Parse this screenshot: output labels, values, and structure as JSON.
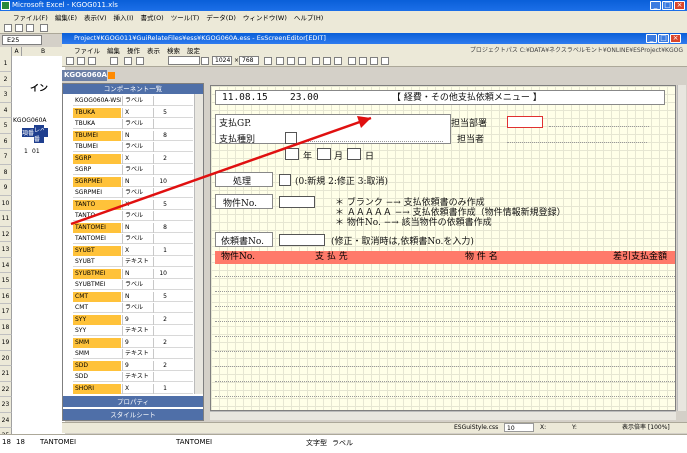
{
  "excel": {
    "title": "Microsoft Excel - KGOG011.xls",
    "menu": [
      "ファイル(F)",
      "編集(E)",
      "表示(V)",
      "挿入(I)",
      "書式(O)",
      "ツール(T)",
      "データ(D)",
      "ウィンドウ(W)",
      "ヘルプ(H)"
    ],
    "namebox": "E25",
    "col_headers": [
      "A",
      "B"
    ],
    "row_numbers": [
      "1",
      "2",
      "3",
      "4",
      "5",
      "6",
      "7",
      "8",
      "9",
      "10",
      "11",
      "12",
      "13",
      "14",
      "15",
      "16",
      "17",
      "18",
      "19",
      "20",
      "21",
      "22",
      "23",
      "24",
      "25"
    ],
    "cells": {
      "title_frag": "イン",
      "r5": "KGOG060A",
      "r6a": "項番",
      "r6b": "レベ",
      "r7": "番",
      "r8": "1",
      "r8b": "01",
      "bottom_row": "18",
      "bottom_b": "18",
      "bottom_c": "TANTOMEI",
      "bottom_d": "TANTOMEI",
      "bottom_e": "文字型",
      "bottom_f": "ラベル"
    }
  },
  "editor": {
    "title": "Project¥KGOG011¥GuiRelateFiles¥ess¥KGOG060A.ess - EsScreenEditor[EDIT]",
    "menu": [
      "ファイル",
      "編集",
      "操作",
      "表示",
      "検索",
      "設定"
    ],
    "project_path": "プロジェクトパス  C:¥DATA¥ネクスラベルモント¥ONLINE¥ESProject¥KGOG",
    "size_w": "1024",
    "size_h": "768",
    "form_tab": "KGOG060A",
    "status_style": "ESGuiStyle.css",
    "status_x": "10",
    "status_x_label": "X:",
    "status_y_label": "Y:",
    "status_zoom": "表示倍率 [100%]"
  },
  "components": {
    "header": "コンポーネント一覧",
    "rows": [
      {
        "name": "KGOG060A-WSNAME",
        "type": "ラベル",
        "len": "",
        "hl": false
      },
      {
        "name": "TBUKA",
        "type": "X",
        "len": "5",
        "hl": true
      },
      {
        "name": "TBUKA",
        "type": "ラベル",
        "len": "",
        "hl": false
      },
      {
        "name": "TBUMEI",
        "type": "N",
        "len": "8",
        "hl": true
      },
      {
        "name": "TBUMEI",
        "type": "ラベル",
        "len": "",
        "hl": false
      },
      {
        "name": "SGRP",
        "type": "X",
        "len": "2",
        "hl": true
      },
      {
        "name": "SGRP",
        "type": "ラベル",
        "len": "",
        "hl": false
      },
      {
        "name": "SGRPMEI",
        "type": "N",
        "len": "10",
        "hl": true
      },
      {
        "name": "SGRPMEI",
        "type": "ラベル",
        "len": "",
        "hl": false
      },
      {
        "name": "TANTO",
        "type": "X",
        "len": "5",
        "hl": true
      },
      {
        "name": "TANTO",
        "type": "ラベル",
        "len": "",
        "hl": false
      },
      {
        "name": "TANTOMEI",
        "type": "N",
        "len": "8",
        "hl": true
      },
      {
        "name": "TANTOMEI",
        "type": "ラベル",
        "len": "",
        "hl": false
      },
      {
        "name": "SYUBT",
        "type": "X",
        "len": "1",
        "hl": true
      },
      {
        "name": "SYUBT",
        "type": "テキスト",
        "len": "",
        "hl": false
      },
      {
        "name": "SYUBTMEI",
        "type": "N",
        "len": "10",
        "hl": true
      },
      {
        "name": "SYUBTMEI",
        "type": "ラベル",
        "len": "",
        "hl": false
      },
      {
        "name": "CMT",
        "type": "N",
        "len": "5",
        "hl": true
      },
      {
        "name": "CMT",
        "type": "ラベル",
        "len": "",
        "hl": false
      },
      {
        "name": "SYY",
        "type": "9",
        "len": "2",
        "hl": true
      },
      {
        "name": "SYY",
        "type": "テキスト",
        "len": "",
        "hl": false
      },
      {
        "name": "SMM",
        "type": "9",
        "len": "2",
        "hl": true
      },
      {
        "name": "SMM",
        "type": "テキスト",
        "len": "",
        "hl": false
      },
      {
        "name": "SDD",
        "type": "9",
        "len": "2",
        "hl": true
      },
      {
        "name": "SDD",
        "type": "テキスト",
        "len": "",
        "hl": false
      },
      {
        "name": "SHORI",
        "type": "X",
        "len": "1",
        "hl": true
      }
    ],
    "property_button": "プロパティ",
    "stylesheet_button": "スタイルシート"
  },
  "form": {
    "date": "11.08.15",
    "time": "23.00",
    "screen_title": "【 経費・その他支払依頼メニュー 】",
    "label_sgrp": "支払GP.",
    "label_dept": "担当部署",
    "label_type": "支払種別",
    "label_person": "担当者",
    "label_year": "年",
    "label_month": "月",
    "label_day": "日",
    "label_process": "処理",
    "process_hint": "(0:新規 2:修正 3:取消)",
    "label_item_no": "物件No.",
    "hint1": "＊ ブランク   −→ 支払依頼書のみ作成",
    "hint2": "＊ ＡＡＡＡＡ −→ 支払依頼書作成（物件情報新規登録）",
    "hint3": "＊ 物件No.    −→ 該当物件の依頼書作成",
    "label_request_no": "依頼書No.",
    "request_hint": "(修正・取消時は,依頼書No.を入力)",
    "table_headers": [
      "物件No.",
      "支 払 先",
      "物 件 名",
      "差引支払金額"
    ]
  }
}
